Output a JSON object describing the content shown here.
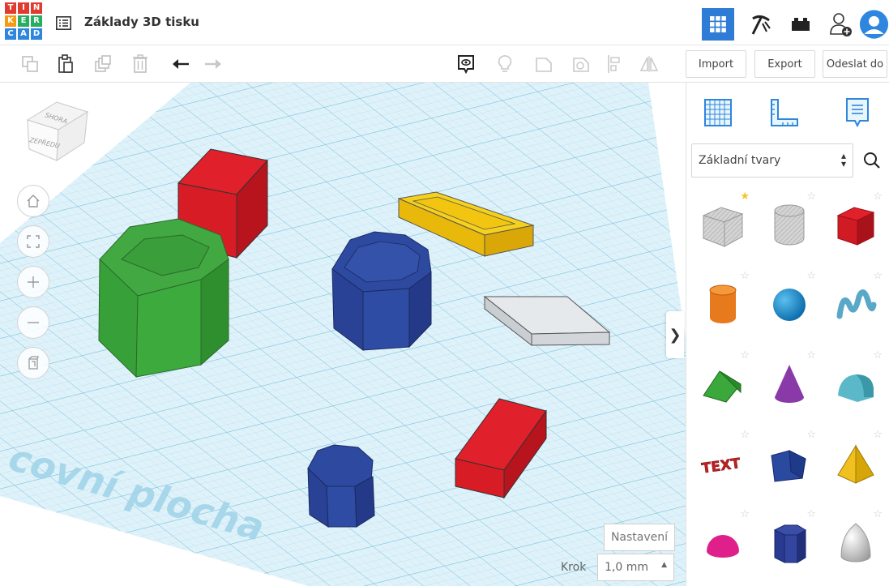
{
  "header": {
    "logo_letters": [
      "T",
      "I",
      "N",
      "K",
      "E",
      "R",
      "C",
      "A",
      "D"
    ],
    "design_title": "Základy 3D tisku",
    "accent": "#2e7cd6",
    "buttons": [
      "grid-view-icon",
      "pickaxe-icon",
      "bricks-icon",
      "add-user-icon",
      "avatar"
    ]
  },
  "toolbar": {
    "import_label": "Import",
    "export_label": "Export",
    "send_label": "Odeslat do"
  },
  "viewcube": {
    "top_label": "SHORA",
    "front_label": "ZEPŘEDU"
  },
  "workplane": {
    "watermark": "covní plocha",
    "grid_color": "#8fd0ea",
    "settings_label": "Nastavení",
    "step_label": "Krok",
    "step_value": "1,0 mm"
  },
  "panel": {
    "category": "Základní tvary",
    "shapes": [
      {
        "name": "box-hole",
        "color": "#c8c8c8",
        "favorite": true
      },
      {
        "name": "cylinder-hole",
        "color": "#c8c8c8",
        "favorite": false
      },
      {
        "name": "box",
        "color": "#d42a2a",
        "favorite": false
      },
      {
        "name": "cylinder",
        "color": "#e87a1e",
        "favorite": false
      },
      {
        "name": "sphere",
        "color": "#1e8fcf",
        "favorite": false
      },
      {
        "name": "scribble",
        "color": "#5aa8c8",
        "favorite": false
      },
      {
        "name": "roof",
        "color": "#3aa83a",
        "favorite": false
      },
      {
        "name": "cone",
        "color": "#8a3aa8",
        "favorite": false
      },
      {
        "name": "round-roof",
        "color": "#5ab8c8",
        "favorite": false
      },
      {
        "name": "text",
        "color": "#c02020",
        "favorite": false
      },
      {
        "name": "polygon",
        "color": "#2a4aa0",
        "favorite": false
      },
      {
        "name": "pyramid",
        "color": "#f0c020",
        "favorite": false
      },
      {
        "name": "half-sphere",
        "color": "#e0208a",
        "favorite": false
      },
      {
        "name": "hexagonal-prism",
        "color": "#2a3a90",
        "favorite": false
      },
      {
        "name": "paraboloid",
        "color": "#d8d8d8",
        "favorite": false
      }
    ],
    "text_shape_label": "TEXT"
  }
}
